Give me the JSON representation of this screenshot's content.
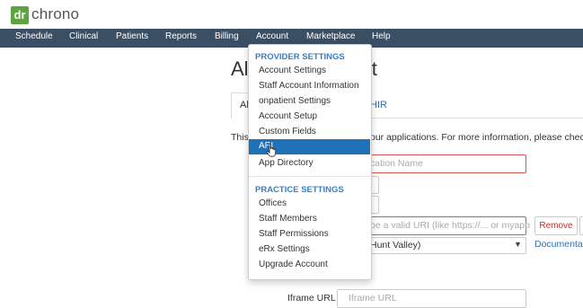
{
  "brand": {
    "logo_mark": "dr",
    "logo_text": "chrono",
    "color": "#5ca43f"
  },
  "nav": {
    "items": [
      "Schedule",
      "Clinical",
      "Patients",
      "Reports",
      "Billing",
      "Account",
      "Marketplace",
      "Help"
    ]
  },
  "page": {
    "title_left": "Al",
    "title_right": "nt",
    "tab_active": "Al",
    "tab_fhir": "HIR",
    "intro_left": "This",
    "intro_right": "our applications. For more information, please check o",
    "name_placeholder": "cation Name",
    "uri_placeholder": "be a valid URI (like https://... or myapp",
    "remove_label": "Remove",
    "select_value": "Hunt Valley)",
    "doc_link": "Documentat",
    "iframe_label": "Iframe URL",
    "iframe_placeholder": "Iframe URL"
  },
  "dropdown": {
    "provider_header": "PROVIDER SETTINGS",
    "provider_items": [
      "Account Settings",
      "Staff Account Information",
      "onpatient Settings",
      "Account Setup",
      "Custom Fields"
    ],
    "active_item": "API",
    "after_active": [
      "App Directory"
    ],
    "practice_header": "PRACTICE SETTINGS",
    "practice_items": [
      "Offices",
      "Staff Members",
      "Staff Permissions",
      "eRx Settings",
      "Upgrade Account"
    ]
  },
  "colors": {
    "nav_bg": "#3a4e64",
    "accent": "#1f72b8",
    "error_border": "#d9534f"
  }
}
